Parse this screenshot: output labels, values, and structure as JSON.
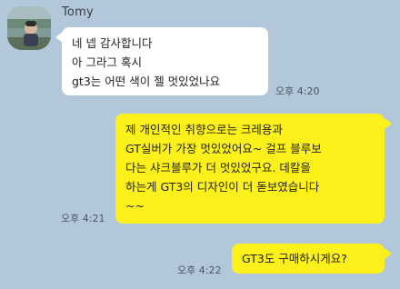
{
  "chat": {
    "sender_name": "Tomy",
    "messages": [
      {
        "direction": "in",
        "lines": [
          "네 넵 감사합니다",
          "아 그라그 혹시",
          "gt3는 어떤 색이 젤 멋있었나요"
        ],
        "time": "오후 4:20"
      },
      {
        "direction": "out",
        "lines": [
          "제 개인적인 취향으로는 크레용과",
          "GT실버가 가장 멋있었어요~ 걸프 블루보",
          "다는 샤크블루가 더 멋있었구요. 데칼을",
          "하는게 GT3의 디자인이 더 돋보였습니다",
          "~~"
        ],
        "time": "오후 4:21"
      },
      {
        "direction": "out",
        "lines": [
          "GT3도 구매하시게요?"
        ],
        "time": "오후 4:22"
      }
    ]
  },
  "colors": {
    "background": "#b2c7d9",
    "incoming_bubble": "#ffffff",
    "outgoing_bubble": "#fef01b"
  }
}
